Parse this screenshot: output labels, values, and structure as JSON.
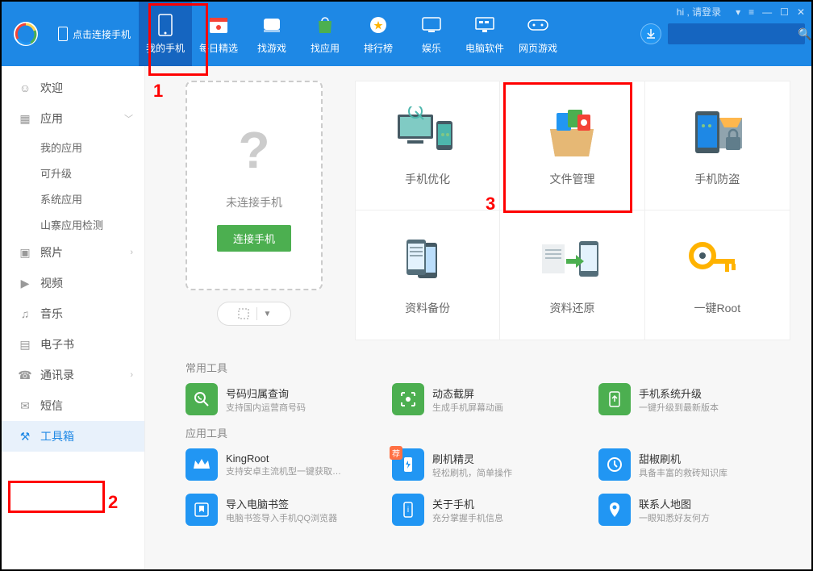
{
  "header": {
    "connect_label": "点击连接手机",
    "login_text": "hi , 请登录",
    "nav": [
      {
        "label": "我的手机"
      },
      {
        "label": "每日精选"
      },
      {
        "label": "找游戏"
      },
      {
        "label": "找应用"
      },
      {
        "label": "排行榜"
      },
      {
        "label": "娱乐"
      },
      {
        "label": "电脑软件"
      },
      {
        "label": "网页游戏"
      }
    ]
  },
  "sidebar": {
    "items": [
      {
        "label": "欢迎"
      },
      {
        "label": "应用"
      },
      {
        "label": "我的应用"
      },
      {
        "label": "可升级"
      },
      {
        "label": "系统应用"
      },
      {
        "label": "山寨应用检测"
      },
      {
        "label": "照片"
      },
      {
        "label": "视频"
      },
      {
        "label": "音乐"
      },
      {
        "label": "电子书"
      },
      {
        "label": "通讯录"
      },
      {
        "label": "短信"
      },
      {
        "label": "工具箱"
      }
    ]
  },
  "phone": {
    "not_connected": "未连接手机",
    "connect_btn": "连接手机"
  },
  "cards": [
    {
      "label": "手机优化"
    },
    {
      "label": "文件管理"
    },
    {
      "label": "手机防盗"
    },
    {
      "label": "资料备份"
    },
    {
      "label": "资料还原"
    },
    {
      "label": "一键Root"
    }
  ],
  "sections": {
    "common": "常用工具",
    "app": "应用工具"
  },
  "common_tools": [
    {
      "title": "号码归属查询",
      "sub": "支持国内运营商号码",
      "color": "#4caf50"
    },
    {
      "title": "动态截屏",
      "sub": "生成手机屏幕动画",
      "color": "#4caf50"
    },
    {
      "title": "手机系统升级",
      "sub": "一键升级到最新版本",
      "color": "#4caf50"
    }
  ],
  "app_tools": [
    {
      "title": "KingRoot",
      "sub": "支持安卓主流机型一键获取…",
      "color": "#2196f3"
    },
    {
      "title": "刷机精灵",
      "sub": "轻松刷机，简单操作",
      "color": "#2196f3"
    },
    {
      "title": "甜椒刷机",
      "sub": "具备丰富的救砖知识库",
      "color": "#2196f3"
    },
    {
      "title": "导入电脑书签",
      "sub": "电脑书签导入手机QQ浏览器",
      "color": "#2196f3"
    },
    {
      "title": "关于手机",
      "sub": "充分掌握手机信息",
      "color": "#2196f3"
    },
    {
      "title": "联系人地图",
      "sub": "一眼知悉好友何方",
      "color": "#2196f3"
    }
  ],
  "annotations": {
    "a1": "1",
    "a2": "2",
    "a3": "3"
  }
}
